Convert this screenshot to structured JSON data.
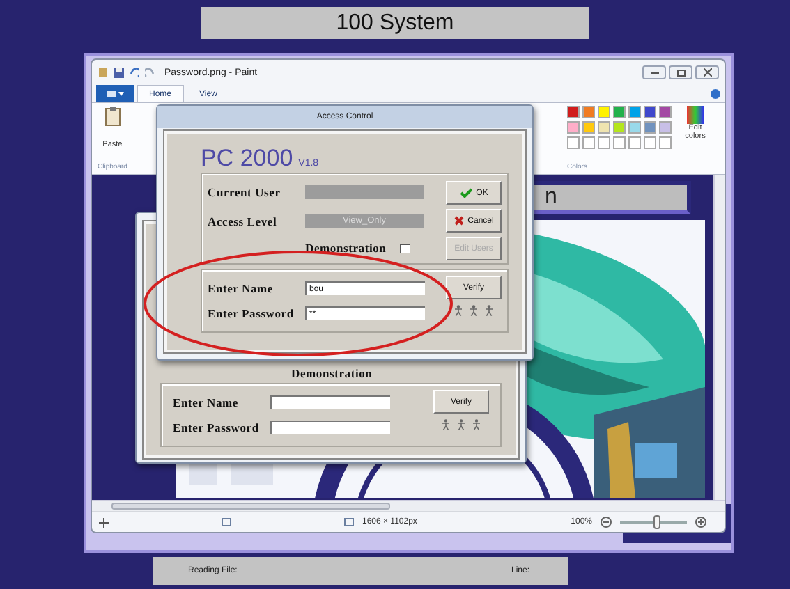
{
  "app_title": "100 System",
  "paint": {
    "title": "Password.png - Paint",
    "tabs": [
      {
        "label": "Home",
        "selected": true
      },
      {
        "label": "View",
        "selected": false
      }
    ],
    "paste": "Paste",
    "clipboard": "Clipboard",
    "colors_group": "Colors",
    "edit_colors": "Edit colors",
    "palette": [
      {
        "color": "#d01c1c"
      },
      {
        "color": "#f07b22"
      },
      {
        "color": "#fff200"
      },
      {
        "color": "#22b14c"
      },
      {
        "color": "#00a2e8"
      },
      {
        "color": "#3f48cc"
      },
      {
        "color": "#a349a4"
      },
      {
        "color": "#ffaec9"
      },
      {
        "color": "#ffc90e"
      },
      {
        "color": "#efe4b0"
      },
      {
        "color": "#b5e61d"
      },
      {
        "color": "#99d9ea"
      },
      {
        "color": "#7092be"
      },
      {
        "color": "#c8bfe7"
      }
    ],
    "banner_text": "n",
    "dimensions": "1606 × 1102px",
    "zoom": "100%",
    "zoom_slider": {
      "level": 0.55
    }
  },
  "back_dialog": {
    "demonstration": "Demonstration",
    "name_label": "Enter Name",
    "password_label": "Enter Password",
    "verify": "Verify"
  },
  "dialog": {
    "title": "Access Control",
    "product": "PC 2000",
    "version": "V1.8",
    "current_user_label": "Current User",
    "access_level_label": "Access Level",
    "access_level": "View_Only",
    "demonstration": "Demonstration",
    "demonstration_checked": false,
    "ok": "OK",
    "cancel": "Cancel",
    "edit_users": "Edit Users",
    "edit_users_disabled": true,
    "name_label": "Enter Name",
    "name_value": "bou",
    "password_label": "Enter Password",
    "password_value": "**",
    "verify": "Verify"
  },
  "status_bar": {
    "reading_file": "Reading File:",
    "line": "Line:"
  }
}
